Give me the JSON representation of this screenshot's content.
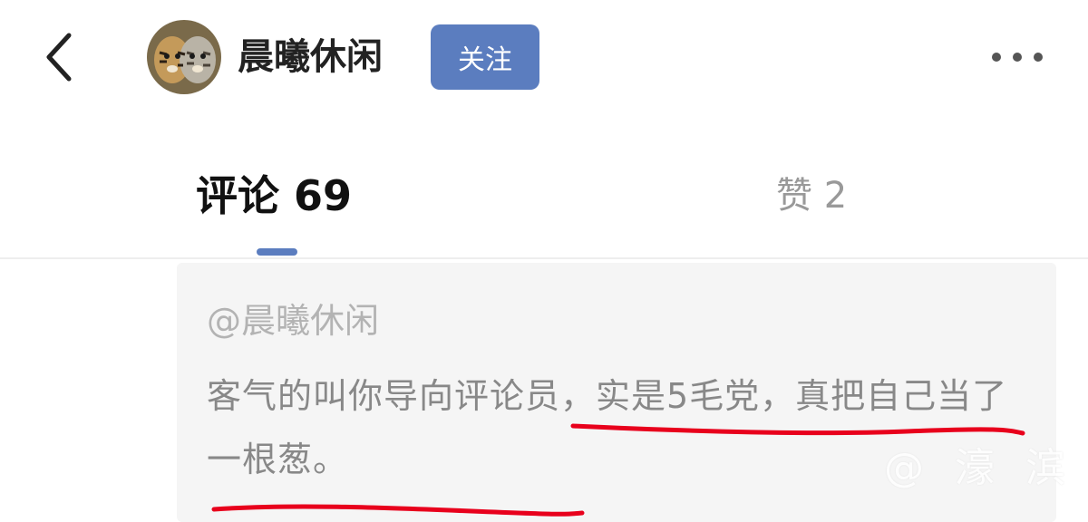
{
  "header": {
    "username": "晨曦休闲",
    "follow_label": "关注"
  },
  "tabs": [
    {
      "label": "评论 69",
      "active": true
    },
    {
      "label": "赞 2",
      "active": false
    }
  ],
  "quote": {
    "author": "@晨曦休闲",
    "text": "客气的叫你导向评论员，实是5毛党，真把自己当了一根葱。"
  },
  "watermark": "@ 濠 滨",
  "icons": {
    "back": "chevron-left-icon",
    "more": "more-horizontal-icon"
  },
  "colors": {
    "accent": "#5b7dbf",
    "annotation": "#e8001c"
  }
}
